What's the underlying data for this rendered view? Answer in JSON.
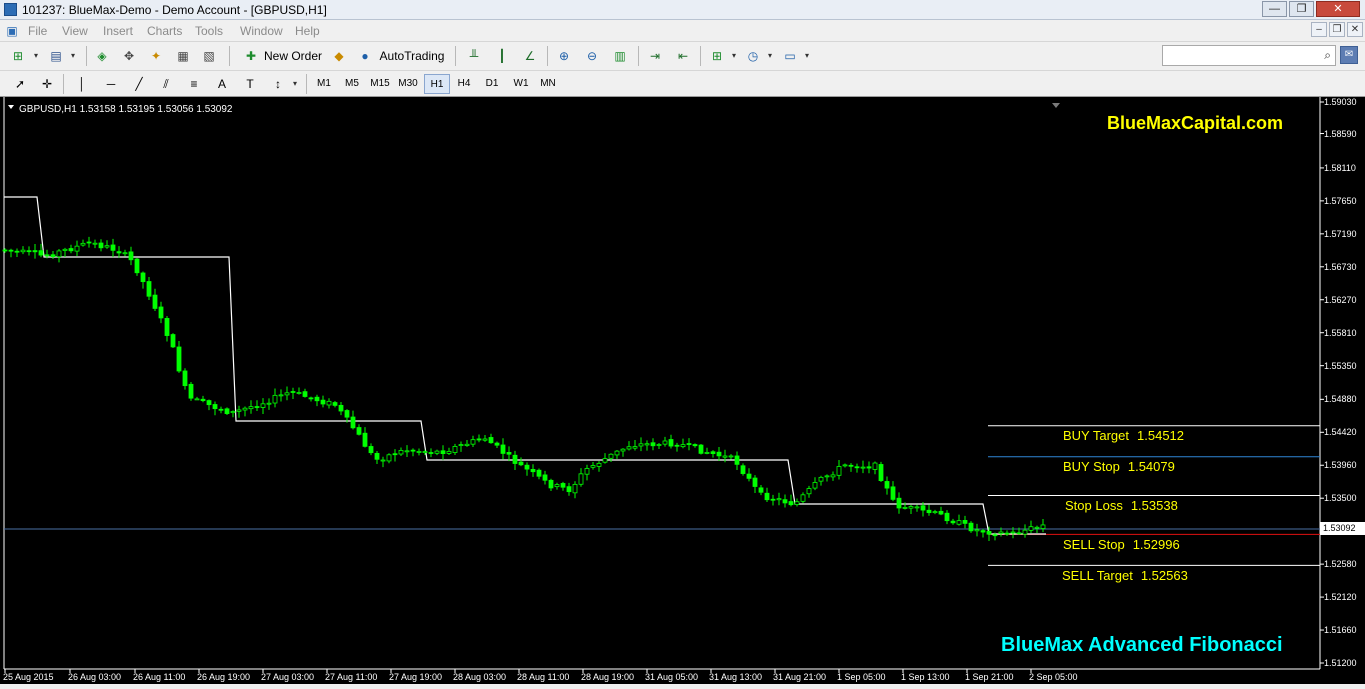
{
  "window": {
    "title": "101237: BlueMax-Demo - Demo Account - [GBPUSD,H1]"
  },
  "menu": [
    "File",
    "View",
    "Insert",
    "Charts",
    "Tools",
    "Window",
    "Help"
  ],
  "toolbar": {
    "new_order": "New Order",
    "autotrading": "AutoTrading"
  },
  "timeframes": [
    "M1",
    "M5",
    "M15",
    "M30",
    "H1",
    "H4",
    "D1",
    "W1",
    "MN"
  ],
  "active_timeframe": "H1",
  "chart": {
    "symbol_info": "GBPUSD,H1  1.53158 1.53195 1.53056 1.53092",
    "brand_top": "BlueMaxCapital.com",
    "brand_bottom": "BlueMax Advanced Fibonacci",
    "current_price": "1.53092",
    "price_labels": [
      "1.59030",
      "1.58590",
      "1.58110",
      "1.57650",
      "1.57190",
      "1.56730",
      "1.56270",
      "1.55810",
      "1.55350",
      "1.54880",
      "1.54420",
      "1.53960",
      "1.53500",
      "1.52580",
      "1.52120",
      "1.51660",
      "1.51200"
    ],
    "time_labels": [
      "25 Aug 2015",
      "26 Aug 03:00",
      "26 Aug 11:00",
      "26 Aug 19:00",
      "27 Aug 03:00",
      "27 Aug 11:00",
      "27 Aug 19:00",
      "28 Aug 03:00",
      "28 Aug 11:00",
      "28 Aug 19:00",
      "31 Aug 05:00",
      "31 Aug 13:00",
      "31 Aug 21:00",
      "1 Sep 05:00",
      "1 Sep 13:00",
      "1 Sep 21:00",
      "2 Sep 05:00"
    ],
    "levels": [
      {
        "label": "BUY Target",
        "value": "1.54512",
        "line_color": "#ffffff"
      },
      {
        "label": "BUY Stop",
        "value": "1.54079",
        "line_color": "#2f86d6"
      },
      {
        "label": "Stop Loss",
        "value": "1.53538",
        "line_color": "#ffffff"
      },
      {
        "label": "SELL Stop",
        "value": "1.52996",
        "line_color": "#e01010"
      },
      {
        "label": "SELL Target",
        "value": "1.52563",
        "line_color": "#ffffff"
      }
    ],
    "colors": {
      "background": "#000000",
      "candles": "#00ff00",
      "brand_top": "#ffff00",
      "brand_bottom": "#00ffff",
      "level_text": "#ffff00",
      "step_line": "#ffffff",
      "bid_line": "#4a6fa5"
    }
  }
}
